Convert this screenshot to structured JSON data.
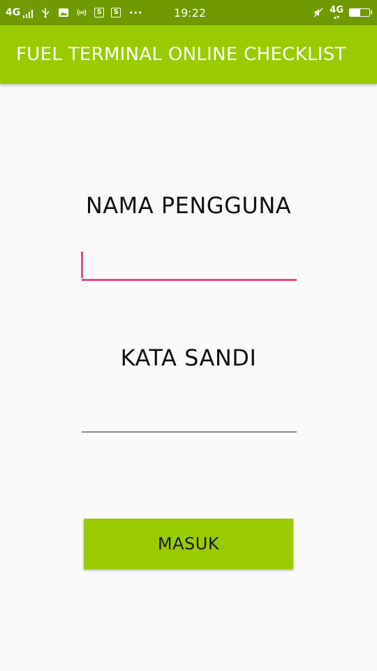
{
  "status_bar": {
    "network_left": "4G",
    "signal_icon": "signal-bars-icon",
    "icons": [
      "usb-icon",
      "image-icon",
      "hotspot-icon",
      "s-app-icon",
      "s-app-icon",
      "more-dots-icon"
    ],
    "s_icon_letter": "S",
    "more_dots": "•••",
    "time": "19:22",
    "mute_icon": "mute-icon",
    "network_right": "4G",
    "battery_level": 0.55,
    "background_color": "#6f9a00"
  },
  "app_bar": {
    "title": "FUEL TERMINAL ONLINE CHECKLIST",
    "background_color": "#99cc00"
  },
  "form": {
    "username_label": "NAMA PENGGUNA",
    "username_value": "",
    "password_label": "KATA SANDI",
    "password_value": "",
    "focus_color": "#e34d7f",
    "submit_label": "MASUK",
    "submit_color": "#99cc00"
  }
}
